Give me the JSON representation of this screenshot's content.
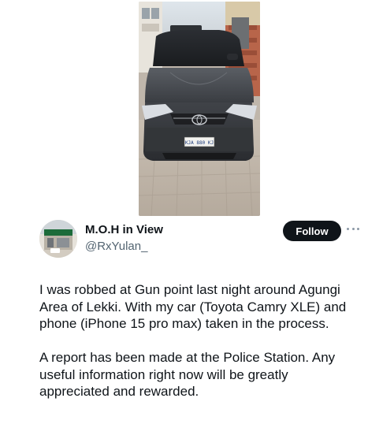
{
  "media": {
    "photo_description_icon": "car-photo",
    "license_plate_text": "KJA 880 KJ"
  },
  "author": {
    "display_name": "M.O.H in View",
    "handle": "@RxYulan_",
    "avatar_icon": "avatar-storefront-photo"
  },
  "actions": {
    "follow_label": "Follow",
    "more_icon": "more-horizontal-icon"
  },
  "tweet": {
    "paragraph_1": "I was robbed at Gun point last night around Agungi Area of Lekki. With my car (Toyota Camry XLE) and phone (iPhone 15 pro max) taken in the process.",
    "paragraph_2": "A report has been made at the Police Station. Any useful information right now will be greatly appreciated and rewarded."
  },
  "colors": {
    "text_primary": "#0f1419",
    "text_secondary": "#536471",
    "follow_bg": "#0f1419",
    "follow_text": "#ffffff"
  }
}
